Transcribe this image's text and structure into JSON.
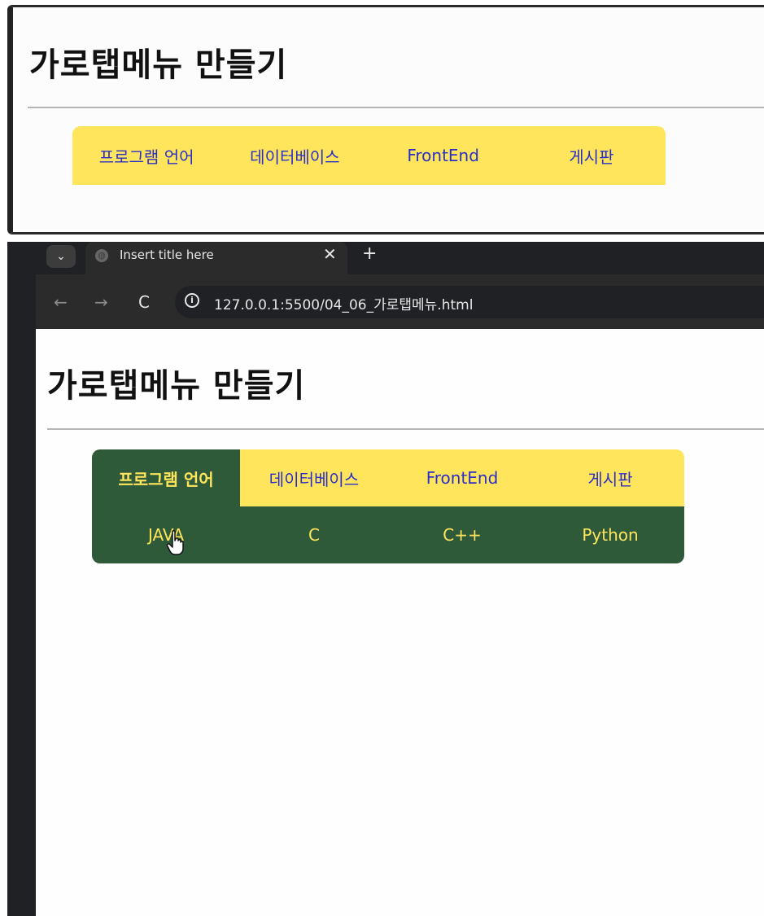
{
  "top_panel": {
    "heading": "가로탭메뉴 만들기",
    "menu": [
      "프로그램 언어",
      "데이터베이스",
      "FrontEnd",
      "게시판"
    ]
  },
  "browser": {
    "tab_title": "Insert title here",
    "close_glyph": "✕",
    "new_tab_glyph": "+",
    "dropdown_glyph": "⌄",
    "back_glyph": "←",
    "forward_glyph": "→",
    "reload_glyph": "C",
    "info_glyph": "i",
    "url": "127.0.0.1:5500/04_06_가로탭메뉴.html"
  },
  "page": {
    "heading": "가로탭메뉴 만들기",
    "menu": [
      "프로그램 언어",
      "데이터베이스",
      "FrontEnd",
      "게시판"
    ],
    "active_tab": "프로그램 언어",
    "submenu": [
      "JAVA",
      "C",
      "C++",
      "Python"
    ]
  },
  "colors": {
    "menu_bg": "#fee55c",
    "menu_text": "#2b2fc7",
    "active_bg": "#2f5a39",
    "active_text": "#fee55c"
  },
  "icons": [
    "dropdown-icon",
    "globe-icon",
    "close-icon",
    "new-tab-icon",
    "back-icon",
    "forward-icon",
    "reload-icon",
    "info-icon",
    "hand-cursor-icon"
  ]
}
